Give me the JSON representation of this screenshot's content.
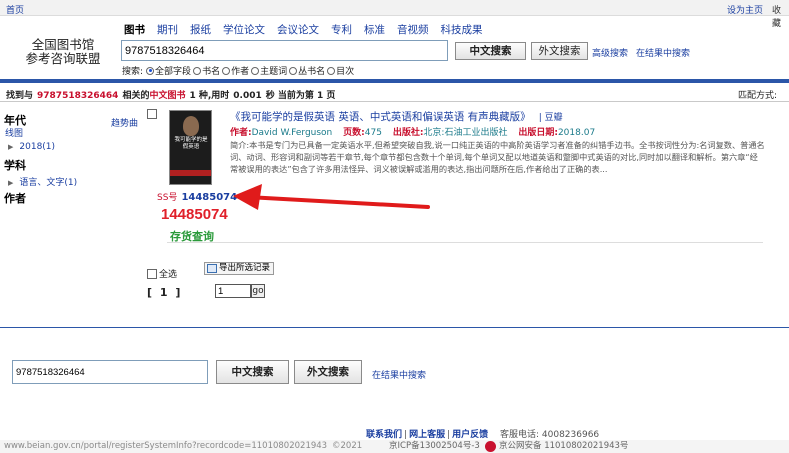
{
  "topbar": {
    "home": "首页",
    "set_home": "设为主页",
    "favorite": "收藏"
  },
  "logo": {
    "line1": "全国图书馆",
    "line2": "参考咨询联盟"
  },
  "tabs": [
    "图书",
    "期刊",
    "报纸",
    "学位论文",
    "会议论文",
    "专利",
    "标准",
    "音视频",
    "科技成果"
  ],
  "search": {
    "query": "9787518326464",
    "zh_button": "中文搜索",
    "en_button": "外文搜索",
    "advanced": "高级搜索",
    "in_results": "在结果中搜索",
    "fields_label": "搜索:",
    "fields": [
      "全部字段",
      "书名",
      "作者",
      "主题词",
      "丛书名",
      "目次"
    ],
    "selected_field": "全部字段"
  },
  "summary": {
    "prefix": "找到与",
    "query": "9787518326464",
    "mid": "相关的",
    "kind": "中文图书",
    "count_text": "1 种,用时",
    "time": "0.001",
    "suffix": "秒 当前为第 1 页",
    "sort_label": "匹配方式:"
  },
  "facets": {
    "year_title": "年代",
    "trend": "趋势曲",
    "line_chart": "线图",
    "year_item": "2018(1)",
    "subject_title": "学科",
    "subject_item": "语言、文字(1)",
    "author_title": "作者"
  },
  "result": {
    "title": "《我可能学的是假英语 英语、中式英语和偏误英语 有声典藏版》",
    "douban": "| 豆瓣",
    "author_label": "作者:",
    "author": "David W.Ferguson",
    "pages_label": "页数:",
    "pages": "475",
    "publisher_label": "出版社:",
    "publisher": "北京:石油工业出版社",
    "date_label": "出版日期:",
    "date": "2018.07",
    "abstract": "简介:本书是专门为已具备一定英语水平,但希望突破自我,说一口纯正英语的中高阶英语学习者准备的纠错手边书。全书按词性分为:名词复数、普通名词、动词、形容词和副词等若干章节,每个章节都包含数十个单词,每个单词又配以地道英语和蹩脚中式英语的对比,同时加以翻译和解析。第六章“经常被误用的表达”包含了许多用法怪异、词义被误解或滥用的表达,指出问题所在后,作者给出了正确的表...",
    "cover_text": "我可能学的是假英语",
    "ss_label": "SS号",
    "ss_number": "14485074",
    "ss_big": "14485074",
    "stock": "存货查询"
  },
  "list_controls": {
    "select_all": "全选",
    "export": "导出所选记录",
    "pager": "[ 1 ]",
    "page_value": "1",
    "go": "go"
  },
  "bottom_search": {
    "query": "9787518326464",
    "zh_button": "中文搜索",
    "en_button": "外文搜索",
    "in_results": "在结果中搜索"
  },
  "footer": {
    "contact": "联系我们",
    "announce": "网上客服",
    "feedback": "用户反馈",
    "hotline": "客服电话: 4008236966",
    "url": "www.beian.gov.cn/portal/registerSystemInfo?recordcode=11010802021943",
    "copyright": "©2021",
    "icp": "京ICP备13002504号-3",
    "police": "京公网安备 11010802021943号"
  },
  "colors": {
    "accent_blue": "#2b56a8",
    "ss_red": "#e0202a",
    "stock_green": "#2a9a3a"
  }
}
